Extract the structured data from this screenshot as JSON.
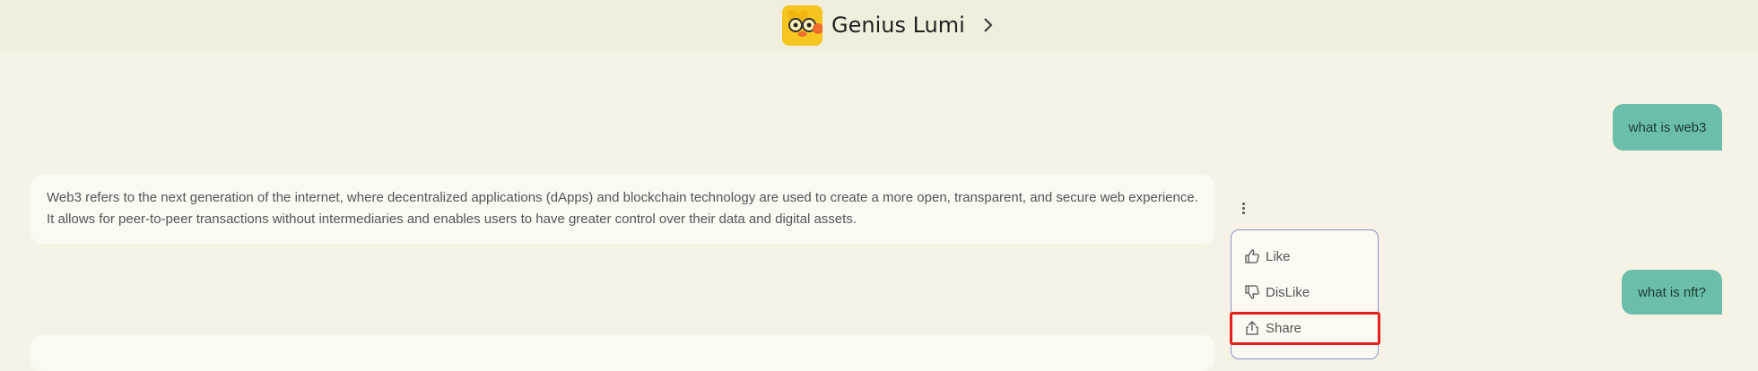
{
  "header": {
    "title": "Genius Lumi"
  },
  "messages": {
    "user1": "what is web3",
    "bot1": "Web3 refers to the next generation of the internet, where decentralized applications (dApps) and blockchain technology are used to create a more open, transparent, and secure web experience. It allows for peer-to-peer transactions without intermediaries and enables users to have greater control over their data and digital assets.",
    "user2": "what is nft?"
  },
  "menu": {
    "like": "Like",
    "dislike": "DisLike",
    "share": "Share"
  },
  "colors": {
    "background": "#f6f3e6",
    "header": "#f1eedd",
    "user_bubble": "#6bbfaa",
    "bot_bubble": "#faf9f2",
    "highlight": "#e3201c",
    "menu_border": "#8a93c8"
  }
}
